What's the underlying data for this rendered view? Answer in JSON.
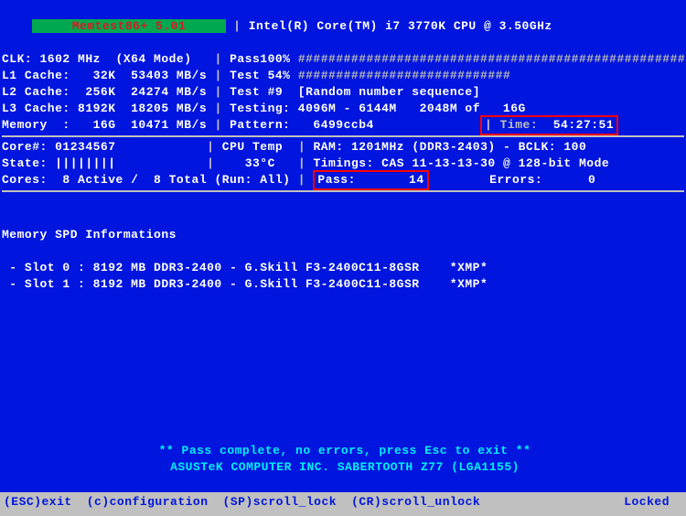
{
  "header": {
    "app_name": "Memtest86+ 5.01",
    "cpu": "Intel(R) Core(TM) i7 3770K CPU @ 3.50GHz",
    "clk": "CLK: 1602 MHz  (X64 Mode)",
    "l1": "L1 Cache:   32K  53403 MB/s",
    "l2": "L2 Cache:  256K  24274 MB/s",
    "l3": "L3 Cache: 8192K  18205 MB/s",
    "mem": "Memory  :   16G  10471 MB/s",
    "pass_pct": "Pass100%",
    "pass_bar": "###################################################",
    "test_pct": "Test 54%",
    "test_bar": "############################",
    "test_no": "Test #9  [Random number sequence]",
    "testing": "Testing: 4096M - 6144M   2048M of   16G",
    "pattern": "Pattern:   6499ccb4",
    "time_label": "| Time:",
    "time_value": "54:27:51"
  },
  "status": {
    "core_ids": "Core#: 01234567",
    "state": "State: ||||||||",
    "cores": "Cores:  8 Active /  8 Total",
    "cpu_temp_label": "CPU Temp",
    "cpu_temp_value": "33°C",
    "run": "(Run: All)",
    "ram": "RAM: 1201MHz (DDR3-2403) - BCLK: 100",
    "timings": "Timings: CAS 11-13-13-30 @ 128-bit Mode",
    "pass_label": "Pass:",
    "pass_value": "14",
    "errors_label": "Errors:",
    "errors_value": "0"
  },
  "spd": {
    "title": "Memory SPD Informations",
    "slot0": " - Slot 0 : 8192 MB DDR3-2400 - G.Skill F3-2400C11-8GSR    *XMP*",
    "slot1": " - Slot 1 : 8192 MB DDR3-2400 - G.Skill F3-2400C11-8GSR    *XMP*"
  },
  "footer": {
    "msg1": "** Pass complete, no errors, press Esc to exit **",
    "msg2": "ASUSTeK COMPUTER INC. SABERTOOTH Z77 (LGA1155)",
    "esc": "(ESC)exit",
    "c": "(c)configuration",
    "sp": "(SP)scroll_lock",
    "cr": "(CR)scroll_unlock",
    "locked": "Locked"
  }
}
